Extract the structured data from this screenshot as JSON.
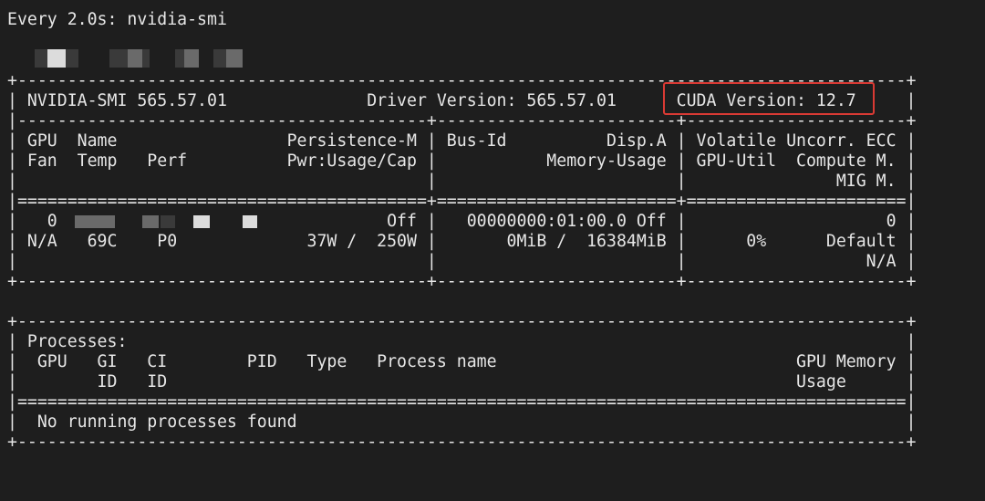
{
  "terminal": {
    "header": "Every 2.0s: nvidia-smi",
    "lines": [
      "+-----------------------------------------------------------------------------------------+",
      "| NVIDIA-SMI 565.57.01              Driver Version: 565.57.01      CUDA Version: 12.7     |",
      "|-----------------------------------------+------------------------+----------------------+",
      "| GPU  Name                 Persistence-M | Bus-Id          Disp.A | Volatile Uncorr. ECC |",
      "| Fan  Temp   Perf          Pwr:Usage/Cap |           Memory-Usage | GPU-Util  Compute M. |",
      "|                                         |                        |               MIG M. |",
      "|=========================================+========================+======================|",
      "|   0                                 Off |   00000000:01:00.0 Off |                    0 |",
      "| N/A   69C    P0             37W /  250W |       0MiB /  16384MiB |      0%      Default |",
      "|                                         |                        |                  N/A |",
      "+-----------------------------------------+------------------------+----------------------+",
      "",
      "+-----------------------------------------------------------------------------------------+",
      "| Processes:                                                                              |",
      "|  GPU   GI   CI        PID   Type   Process name                              GPU Memory |",
      "|        ID   ID                                                               Usage      |",
      "|=========================================================================================|",
      "|  No running processes found                                                             |",
      "+-----------------------------------------------------------------------------------------+"
    ]
  },
  "colors": {
    "background": "#1e1e1e",
    "text": "#e6e6e6",
    "highlight_border": "#d93a34"
  }
}
